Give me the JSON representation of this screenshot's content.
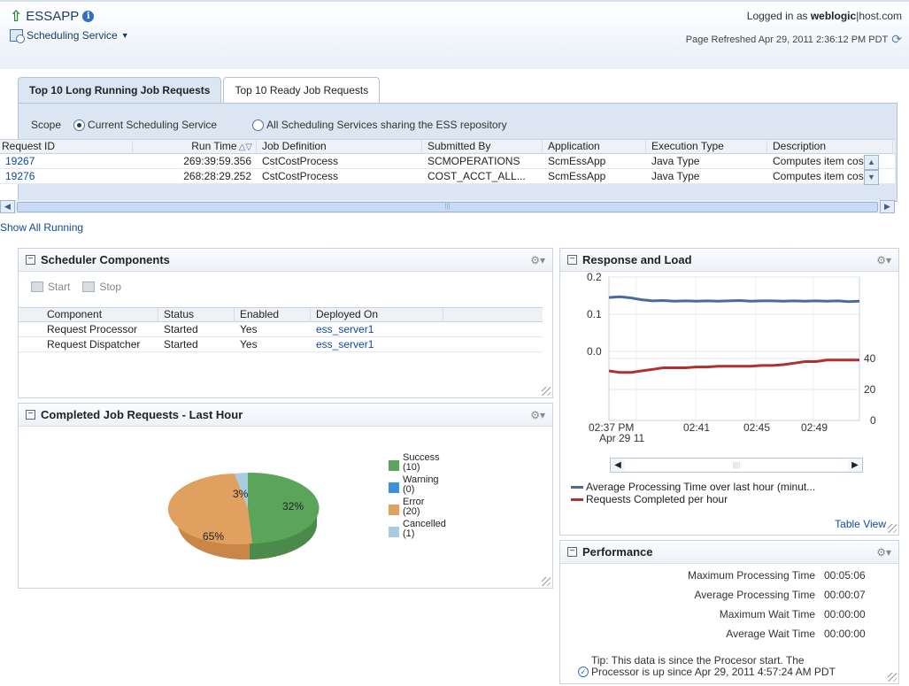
{
  "header": {
    "app_title": "ESSAPP",
    "service_menu": "Scheduling Service",
    "logged_in_prefix": "Logged in as",
    "user": "weblogic",
    "separator": "|",
    "host": "host.com",
    "page_refreshed": "Page Refreshed Apr 29, 2011 2:36:12 PM PDT"
  },
  "tabs": [
    {
      "label": "Top 10 Long Running Job Requests",
      "active": true
    },
    {
      "label": "Top 10 Ready Job Requests",
      "active": false
    }
  ],
  "scope": {
    "label": "Scope",
    "option_current": "Current Scheduling Service",
    "option_all": "All Scheduling Services sharing the ESS repository",
    "selected": "current"
  },
  "jobs_table": {
    "columns": [
      "Request ID",
      "Run Time",
      "Job Definition",
      "Submitted By",
      "Application",
      "Execution Type",
      "Description"
    ],
    "rows": [
      [
        "19267",
        "269:39:59.356",
        "CstCostProcess",
        "SCMOPERATIONS",
        "ScmEssApp",
        "Java Type",
        "Computes item cos..."
      ],
      [
        "19276",
        "268:28:29.252",
        "CstCostProcess",
        "COST_ACCT_ALL...",
        "ScmEssApp",
        "Java Type",
        "Computes item cos..."
      ]
    ],
    "show_all_link": "Show All Running"
  },
  "scheduler_components": {
    "title": "Scheduler Components",
    "start_label": "Start",
    "stop_label": "Stop",
    "columns": [
      "Component",
      "Status",
      "Enabled",
      "Deployed On"
    ],
    "rows": [
      [
        "Request Processor",
        "Started",
        "Yes",
        "ess_server1"
      ],
      [
        "Request Dispatcher",
        "Started",
        "Yes",
        "ess_server1"
      ]
    ]
  },
  "completed_jobs": {
    "title": "Completed Job Requests - Last Hour",
    "slice_labels": [
      "32%",
      "65%",
      "3%"
    ],
    "legend": [
      {
        "name": "Success",
        "count": "(10)",
        "color": "#5aa55a"
      },
      {
        "name": "Warning",
        "count": "(0)",
        "color": "#3d8fe0"
      },
      {
        "name": "Error",
        "count": "(20)",
        "color": "#e0a060"
      },
      {
        "name": "Cancelled",
        "count": "(1)",
        "color": "#a8cde0"
      }
    ]
  },
  "response_load": {
    "title": "Response and Load",
    "table_view_link": "Table View",
    "legend_1": "Average Processing Time over last hour (minut...",
    "legend_2": "Requests Completed per hour"
  },
  "chart_data": {
    "type": "line",
    "x_tick_labels": [
      "02:37 PM",
      "02:41",
      "02:45",
      "02:49"
    ],
    "x_sub_label": "Apr 29 11",
    "left_axis_ticks": [
      "0.2",
      "0.1",
      "0.0"
    ],
    "right_axis_ticks": [
      "40",
      "20",
      "0"
    ],
    "left_ylim": [
      0.0,
      0.2
    ],
    "right_ylim": [
      0,
      40
    ],
    "grid": true,
    "series": [
      {
        "name": "Average Processing Time over last hour (minut...",
        "axis": "left",
        "color": "#4a6a9e",
        "values": [
          0.145,
          0.147,
          0.144,
          0.139,
          0.136,
          0.137,
          0.135,
          0.136,
          0.135,
          0.136,
          0.135,
          0.136,
          0.137,
          0.135,
          0.136,
          0.136,
          0.135,
          0.136,
          0.135,
          0.136,
          0.135,
          0.136,
          0.134,
          0.135
        ]
      },
      {
        "name": "Requests Completed per hour",
        "axis": "right",
        "color": "#b03030",
        "values": [
          32,
          31,
          31,
          32,
          33,
          34,
          34,
          34,
          34.5,
          34.5,
          35,
          35,
          35,
          35,
          35.5,
          35.5,
          36,
          37,
          38,
          38,
          39,
          39,
          39,
          39
        ]
      }
    ]
  },
  "performance": {
    "title": "Performance",
    "rows": [
      {
        "label": "Maximum Processing Time",
        "value": "00:05:06"
      },
      {
        "label": "Average Processing Time",
        "value": "00:00:07"
      },
      {
        "label": "Maximum Wait Time",
        "value": "00:00:00"
      },
      {
        "label": "Average Wait Time",
        "value": "00:00:00"
      }
    ],
    "tip_line1": "Tip: This data is since the Procesor start. The",
    "tip_line2": "Processor is up since Apr 29, 2011 4:57:24 AM PDT"
  }
}
